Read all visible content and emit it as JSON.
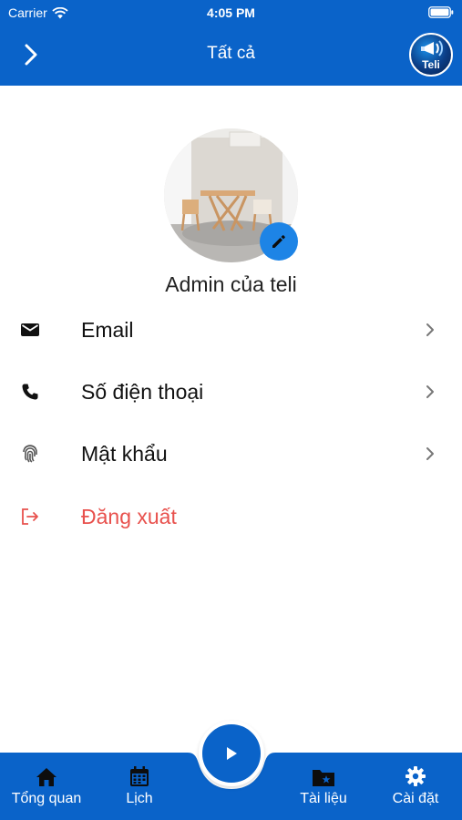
{
  "status_bar": {
    "carrier": "Carrier",
    "time": "4:05 PM"
  },
  "header": {
    "title": "Tất cả",
    "logo_text": "Teli"
  },
  "profile": {
    "name": "Admin của teli"
  },
  "menu": {
    "items": [
      {
        "label": "Email",
        "icon": "email-icon"
      },
      {
        "label": "Số điện thoại",
        "icon": "phone-icon"
      },
      {
        "label": "Mật khẩu",
        "icon": "fingerprint-icon"
      },
      {
        "label": "Đăng xuất",
        "icon": "logout-icon"
      }
    ]
  },
  "tabbar": {
    "tabs": [
      {
        "label": "Tổng quan",
        "icon": "home-icon"
      },
      {
        "label": "Lịch",
        "icon": "calendar-icon"
      },
      {
        "label": "Tài liệu",
        "icon": "folder-star-icon"
      },
      {
        "label": "Cài đặt",
        "icon": "gear-icon"
      }
    ],
    "center_button": "play-icon"
  },
  "colors": {
    "primary": "#0a63c9",
    "accent": "#1d84e6",
    "danger": "#e8514d"
  }
}
